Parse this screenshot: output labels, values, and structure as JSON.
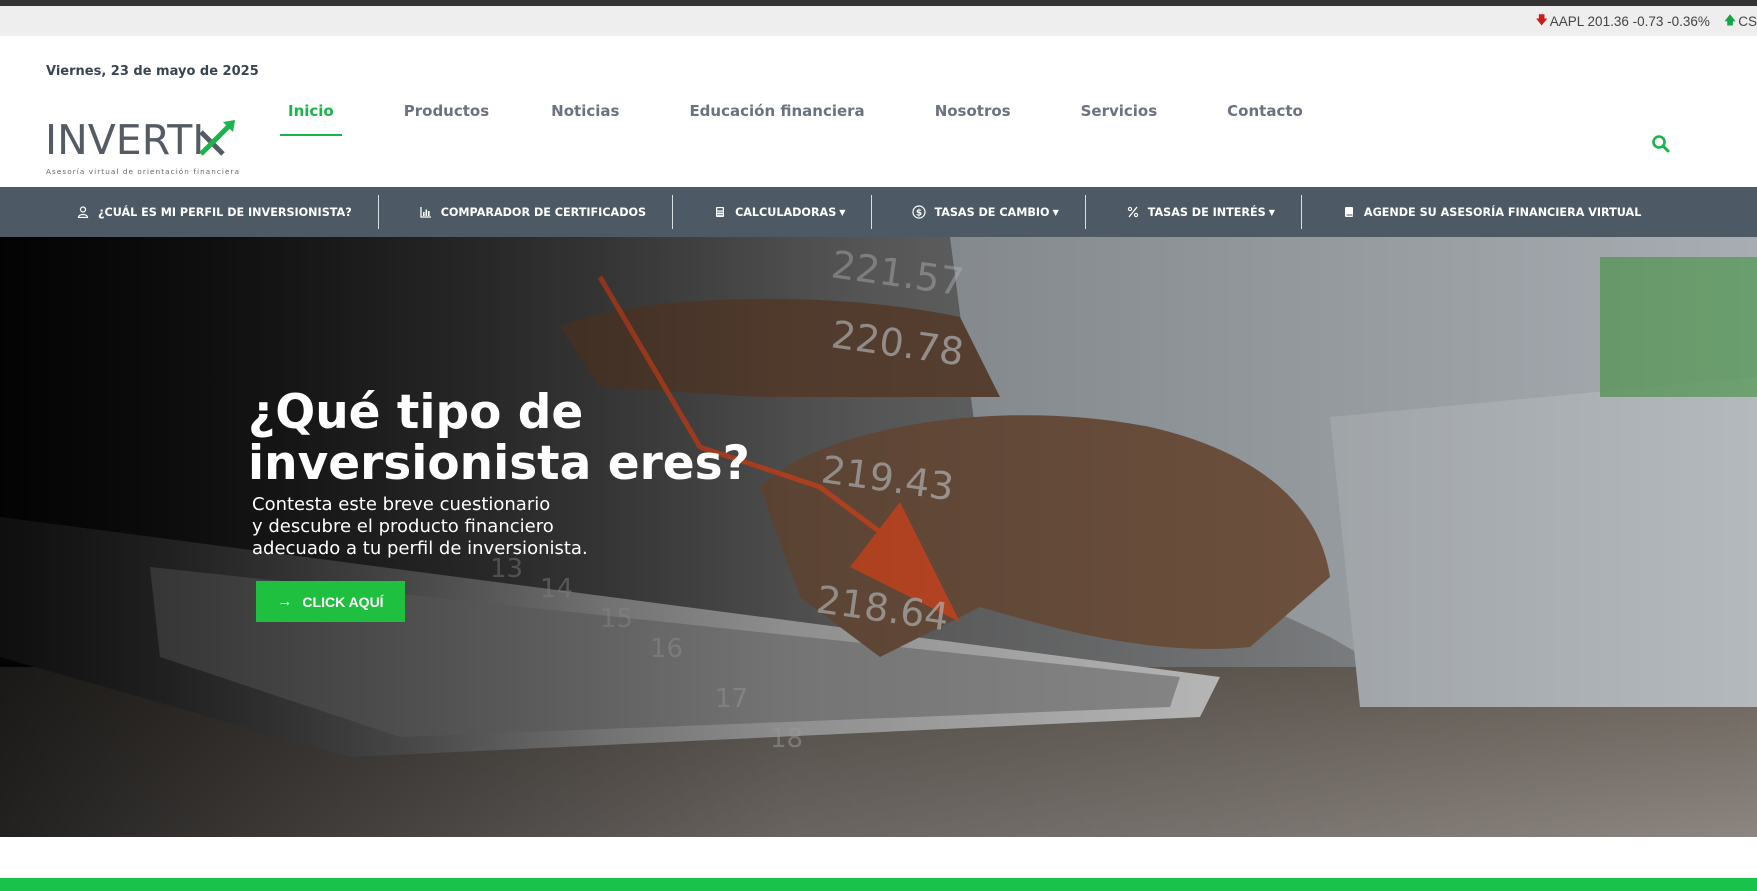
{
  "ticker": {
    "items": [
      {
        "direction": "down",
        "text": "AAPL 201.36 -0.73 -0.36%"
      },
      {
        "direction": "up",
        "text": "CS"
      }
    ],
    "down_color": "#d11a1a",
    "up_color": "#16a34a"
  },
  "header": {
    "date": "Viernes, 23 de mayo de 2025",
    "logo_text": "INVERTIX",
    "logo_tagline": "Asesoría virtual de orientación financiera",
    "accent_color": "#18b54a"
  },
  "mainnav": {
    "items": [
      {
        "label": "Inicio",
        "active": true
      },
      {
        "label": "Productos"
      },
      {
        "label": "Noticias"
      },
      {
        "label": "Educación financiera"
      },
      {
        "label": "Nosotros"
      },
      {
        "label": "Servicios"
      },
      {
        "label": "Contacto"
      }
    ],
    "search_icon": "search-icon"
  },
  "subnav": {
    "items": [
      {
        "icon": "user-icon",
        "label": "¿CUÁL ES MI PERFIL DE INVERSIONISTA?"
      },
      {
        "icon": "bar-chart-icon",
        "label": "COMPARADOR DE CERTIFICADOS"
      },
      {
        "icon": "calculator-icon",
        "label": "CALCULADORAS"
      },
      {
        "icon": "dollar-circle-icon",
        "label": "TASAS DE CAMBIO"
      },
      {
        "icon": "percent-icon",
        "label": "TASAS DE INTERÉS"
      },
      {
        "icon": "book-icon",
        "label": "AGENDE SU ASESORÍA FINANCIERA VIRTUAL"
      }
    ],
    "background": "#4d5a66"
  },
  "hero": {
    "title_line1": "¿Qué tipo de",
    "title_line2": "inversionista eres?",
    "sub_line1": "Contesta este breve cuestionario",
    "sub_line2": "y descubre el producto financiero",
    "sub_line3": "adecuado a tu perfil de inversionista.",
    "button_label": "CLICK AQUÍ",
    "button_color": "#1fbf3f",
    "background_numbers": [
      "221.57",
      "220.78",
      "219.43",
      "218.64",
      "13",
      "14",
      "15",
      "16",
      "17",
      "18"
    ]
  }
}
